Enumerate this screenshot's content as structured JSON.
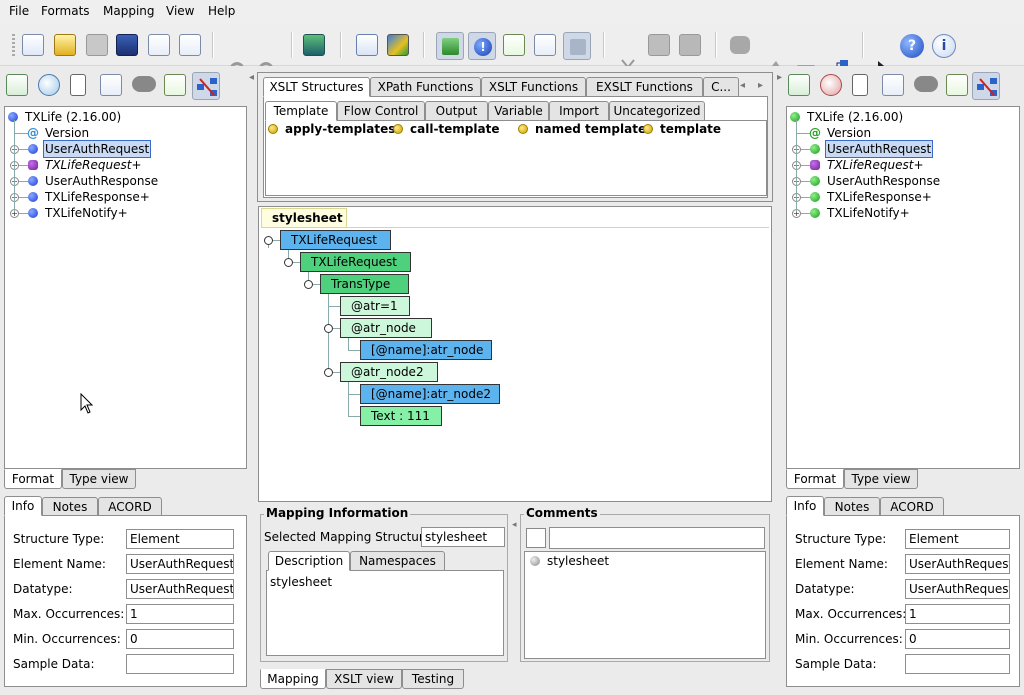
{
  "menu": [
    "File",
    "Formats",
    "Mapping",
    "View",
    "Help"
  ],
  "toolbar_icons": [
    "new-file-icon",
    "open-folder-icon",
    "save-disabled-icon",
    "save-icon",
    "new-page-icon",
    "page-export-icon",
    "undo-icon",
    "redo-icon",
    "import-icon",
    "list-icon",
    "components-icon",
    "structure-toggle-icon",
    "info-toggle-icon",
    "edit-icon",
    "function-icon",
    "pin-icon",
    "cut-icon",
    "copy-icon",
    "paste-icon",
    "puzzle-icon",
    "up-icon",
    "down-icon",
    "link-icon",
    "pointer-help-icon",
    "help-icon",
    "about-icon"
  ],
  "left_tree": {
    "root": "TXLife (2.16.00)",
    "items": [
      {
        "label": "Version",
        "kind": "at"
      },
      {
        "label": "UserAuthRequest",
        "kind": "node",
        "selected": true
      },
      {
        "label": "TXLifeRequest+",
        "kind": "special"
      },
      {
        "label": "UserAuthResponse",
        "kind": "node"
      },
      {
        "label": "TXLifeResponse+",
        "kind": "node"
      },
      {
        "label": "TXLifeNotify+",
        "kind": "node"
      }
    ]
  },
  "right_tree": {
    "root": "TXLife (2.16.00)",
    "items": [
      {
        "label": "Version",
        "kind": "at"
      },
      {
        "label": "UserAuthRequest",
        "kind": "node",
        "selected": true
      },
      {
        "label": "TXLifeRequest+",
        "kind": "special"
      },
      {
        "label": "UserAuthResponse",
        "kind": "node"
      },
      {
        "label": "TXLifeResponse+",
        "kind": "node"
      },
      {
        "label": "TXLifeNotify+",
        "kind": "node"
      }
    ]
  },
  "view_tabs": {
    "format": "Format",
    "type_view": "Type view"
  },
  "info_tabs": {
    "info": "Info",
    "notes": "Notes",
    "acord": "ACORD"
  },
  "info": {
    "structure_type_label": "Structure Type:",
    "structure_type": "Element",
    "element_name_label": "Element Name:",
    "element_name": "UserAuthRequest",
    "datatype_label": "Datatype:",
    "datatype": "UserAuthRequest_",
    "max_occ_label": "Max. Occurrences:",
    "max_occ": "1",
    "min_occ_label": "Min. Occurrences:",
    "min_occ": "0",
    "sample_label": "Sample Data:",
    "sample": ""
  },
  "function_tabs": [
    "XSLT Structures",
    "XPath Functions",
    "XSLT Functions",
    "EXSLT Functions",
    "C..."
  ],
  "category_tabs": [
    "Template",
    "Flow Control",
    "Output",
    "Variable",
    "Import",
    "Uncategorized"
  ],
  "template_items": [
    "apply-templates",
    "call-template",
    "named template",
    "template"
  ],
  "mapping_tree": {
    "root_tab": "stylesheet",
    "nodes": [
      "TXLifeRequest",
      "TXLifeRequest",
      "TransType",
      "@atr=1",
      "@atr_node",
      "[@name]:atr_node",
      "@atr_node2",
      "[@name]:atr_node2",
      "Text : 111"
    ]
  },
  "mapping_info": {
    "title": "Mapping Information",
    "selected_label": "Selected Mapping Structure:",
    "selected_value": "stylesheet",
    "tab_description": "Description",
    "tab_namespaces": "Namespaces",
    "description": "stylesheet"
  },
  "comments": {
    "title": "Comments",
    "input": "",
    "items": [
      "stylesheet"
    ]
  },
  "bottom_tabs": [
    "Mapping",
    "XSLT view",
    "Testing"
  ]
}
